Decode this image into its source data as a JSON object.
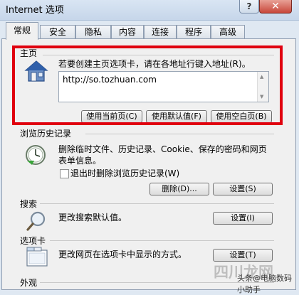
{
  "window": {
    "title": "Internet 选项",
    "help_label": "?",
    "close_label": "✕"
  },
  "tabs": [
    {
      "label": "常规",
      "active": true
    },
    {
      "label": "安全"
    },
    {
      "label": "隐私"
    },
    {
      "label": "内容"
    },
    {
      "label": "连接"
    },
    {
      "label": "程序"
    },
    {
      "label": "高级"
    }
  ],
  "home": {
    "section_label": "主页",
    "instruction": "若要创建主页选项卡，请在各地址行键入地址(R)。",
    "url": "http://so.tozhuan.com",
    "buttons": {
      "use_current": "使用当前页(C)",
      "use_default": "使用默认值(F)",
      "use_blank": "使用空白页(B)"
    },
    "icon": "home-icon"
  },
  "history": {
    "section_label": "浏览历史记录",
    "description_line1": "删除临时文件、历史记录、Cookie、保存的密码和网页",
    "description_line2": "表单信息。",
    "checkbox_label": "退出时删除浏览历史记录(W)",
    "delete_button": "删除(D)...",
    "settings_button": "设置(S)",
    "icon": "clock-icon"
  },
  "search": {
    "section_label": "搜索",
    "description": "更改搜索默认值。",
    "settings_button": "设置(I)",
    "icon": "magnifier-icon"
  },
  "tabs_section": {
    "section_label": "选项卡",
    "description": "更改网页在选项卡中显示的方式。",
    "settings_button": "设置(T)",
    "icon": "tabs-icon"
  },
  "appearance": {
    "section_label": "外观"
  },
  "watermark": {
    "brand": "四川龙网",
    "sub": "头条@电脑数码小助手"
  },
  "colors": {
    "highlight_box": "#e0000f",
    "accent": "#3b6db5"
  }
}
